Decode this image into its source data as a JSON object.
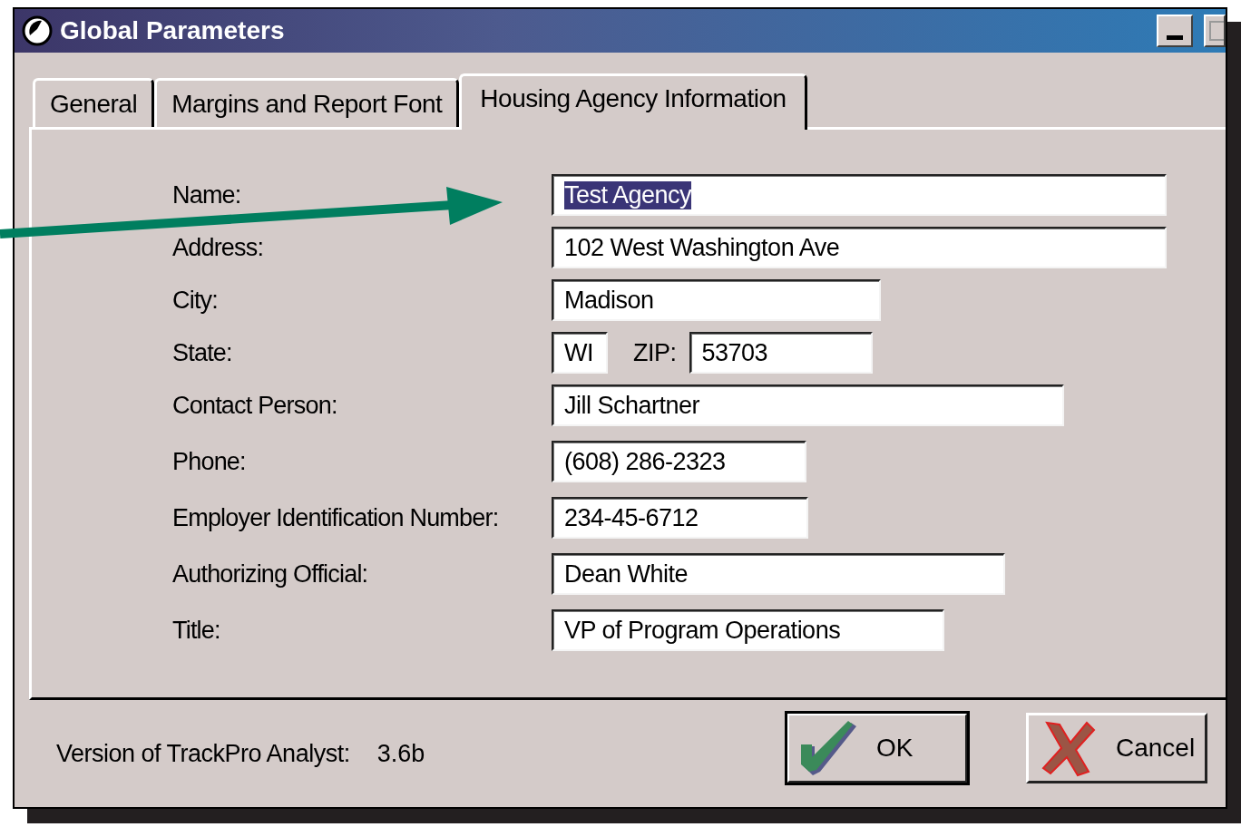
{
  "window": {
    "title": "Global Parameters"
  },
  "tabs": [
    {
      "label": "General",
      "selected": false
    },
    {
      "label": "Margins and Report Font",
      "selected": false
    },
    {
      "label": "Housing Agency Information",
      "selected": true
    }
  ],
  "form": [
    {
      "label": "Name:",
      "fields": [
        {
          "value": "Test Agency",
          "selected": true
        }
      ]
    },
    {
      "label": "Address:",
      "fields": [
        {
          "value": "102 West Washington Ave",
          "selected": false
        }
      ]
    },
    {
      "label": "City:",
      "fields": [
        {
          "value": "Madison",
          "selected": false
        }
      ]
    },
    {
      "label": "State:",
      "fields": [
        {
          "value": "WI",
          "selected": false
        },
        {
          "label": "ZIP:",
          "value": "53703",
          "selected": false
        }
      ]
    },
    {
      "label": "Contact Person:",
      "fields": [
        {
          "value": "Jill Schartner",
          "selected": false
        }
      ]
    },
    {
      "label": "Phone:",
      "fields": [
        {
          "value": "(608) 286-2323",
          "selected": false
        }
      ]
    },
    {
      "label": "Employer Identification Number:",
      "fields": [
        {
          "value": "234-45-6712",
          "selected": false
        }
      ]
    },
    {
      "label": "Authorizing Official:",
      "fields": [
        {
          "value": "Dean White",
          "selected": false
        }
      ]
    },
    {
      "label": "Title:",
      "fields": [
        {
          "value": "VP of Program Operations",
          "selected": false
        }
      ]
    }
  ],
  "footer": {
    "version_label": "Version of TrackPro Analyst:",
    "version": "3.6b"
  },
  "buttons": [
    {
      "kind": "ok",
      "label": "OK"
    },
    {
      "kind": "cancel",
      "label": "Cancel"
    }
  ]
}
